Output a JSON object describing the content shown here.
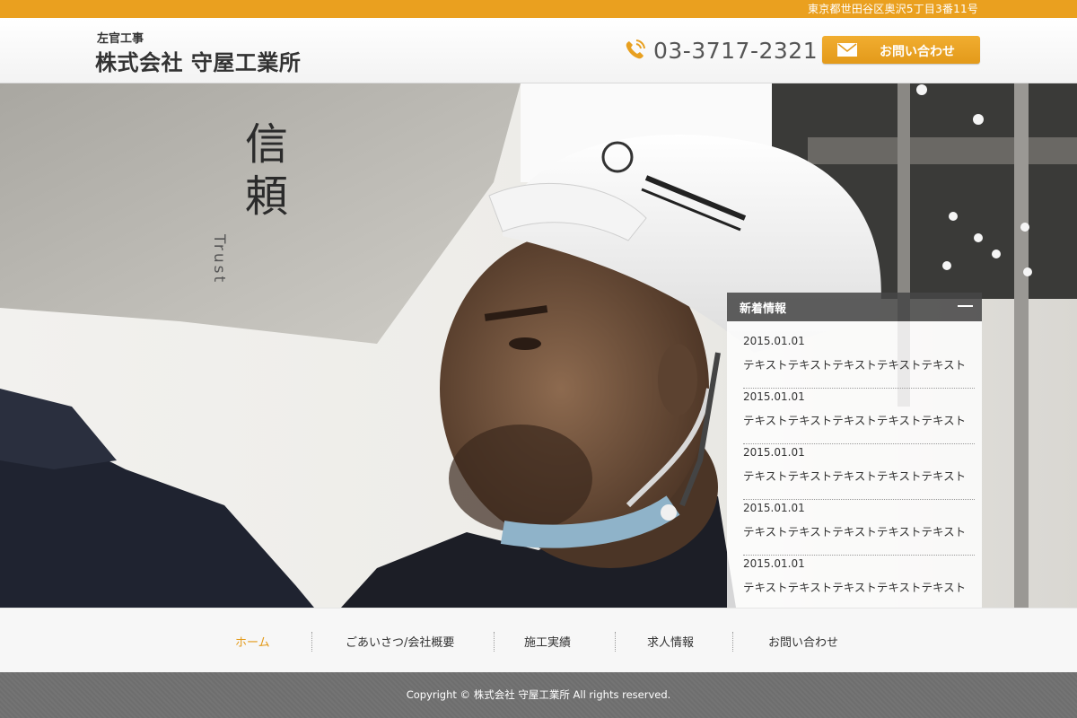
{
  "top_bar": {
    "address": "東京都世田谷区奥沢5丁目3番11号"
  },
  "header": {
    "logo_sub": "左官工事",
    "logo_main": "株式会社 守屋工業所",
    "phone": "03-3717-2321",
    "phone_icon": "phone-icon",
    "contact_button": "お問い合わせ",
    "contact_icon": "mail-icon"
  },
  "hero": {
    "kanji": "信頼",
    "roman": "Trust"
  },
  "news": {
    "title": "新着情報",
    "toggle_icon": "minus-icon",
    "items": [
      {
        "date": "2015.01.01",
        "text": "テキストテキストテキストテキストテキスト"
      },
      {
        "date": "2015.01.01",
        "text": "テキストテキストテキストテキストテキスト"
      },
      {
        "date": "2015.01.01",
        "text": "テキストテキストテキストテキストテキスト"
      },
      {
        "date": "2015.01.01",
        "text": "テキストテキストテキストテキストテキスト"
      },
      {
        "date": "2015.01.01",
        "text": "テキストテキストテキストテキストテキスト"
      }
    ]
  },
  "nav": {
    "items": [
      {
        "label": "ホーム",
        "active": true
      },
      {
        "label": "ごあいさつ/会社概要",
        "active": false
      },
      {
        "label": "施工実績",
        "active": false
      },
      {
        "label": "求人情報",
        "active": false
      },
      {
        "label": "お問い合わせ",
        "active": false
      }
    ]
  },
  "footer": {
    "copyright": "Copyright © 株式会社 守屋工業所 All rights reserved."
  },
  "colors": {
    "accent": "#eaa01f",
    "text": "#333333",
    "footer": "#707070"
  }
}
